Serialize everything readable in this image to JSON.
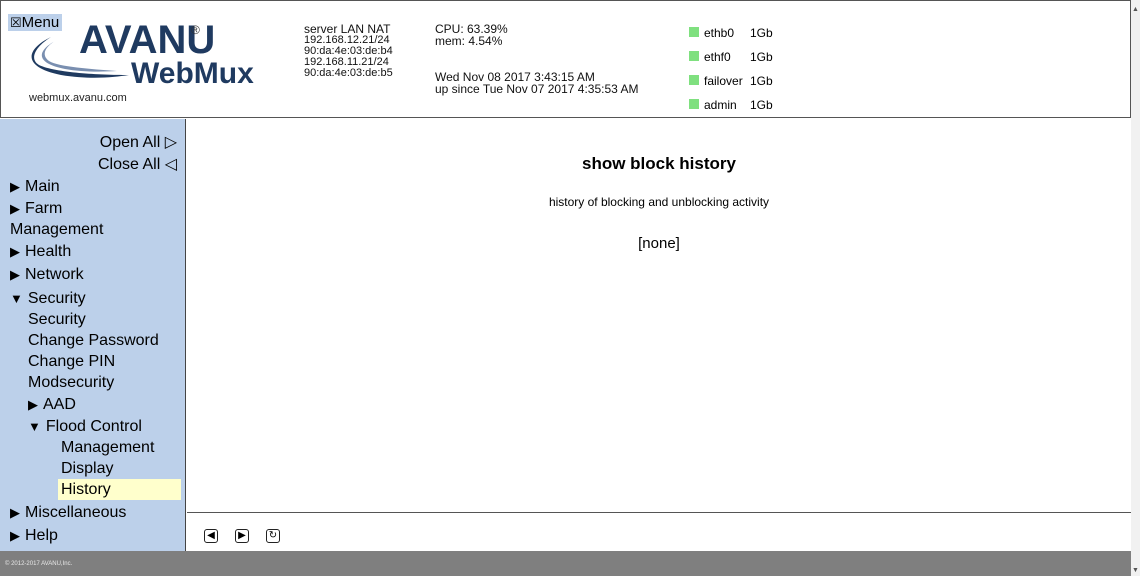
{
  "header": {
    "menu_label": "Menu",
    "menu_icon": "☒",
    "logo": {
      "brand": "AVANU",
      "reg": "®",
      "product": "WebMux"
    },
    "url": "webmux.avanu.com",
    "server": {
      "line1": "server LAN NAT",
      "ip1": "192.168.12.21/24",
      "mac1": "90:da:4e:03:de:b4",
      "ip2": "192.168.11.21/24",
      "mac2": "90:da:4e:03:de:b5"
    },
    "stats": {
      "cpu": "CPU: 63.39%",
      "mem": "mem: 4.54%",
      "date": "Wed Nov 08 2017 3:43:15 AM",
      "uptime": "up since Tue Nov 07 2017 4:35:53 AM"
    },
    "interfaces": [
      {
        "name": "ethb0",
        "speed": "1Gb",
        "status_color": "#7fe07f"
      },
      {
        "name": "ethf0",
        "speed": "1Gb",
        "status_color": "#7fe07f"
      },
      {
        "name": "failover",
        "speed": "1Gb",
        "status_color": "#7fe07f"
      },
      {
        "name": "admin",
        "speed": "1Gb",
        "status_color": "#7fe07f"
      }
    ]
  },
  "sidebar": {
    "open_all": "Open All ▷",
    "close_all": "Close All ◁",
    "collapsed_arrow": "▶",
    "expanded_arrow": "▼",
    "items": {
      "main": "Main",
      "farm": "Farm",
      "management": "Management",
      "health": "Health",
      "network": "Network",
      "security": "Security",
      "security_sub": "Security",
      "change_password": "Change Password",
      "change_pin": "Change PIN",
      "modsecurity": "Modsecurity",
      "aad": "AAD",
      "flood_control": "Flood Control",
      "fc_management": "Management",
      "fc_display": "Display",
      "fc_history": "History",
      "miscellaneous": "Miscellaneous",
      "help": "Help"
    },
    "selected_bg": "#ffffcc",
    "bg": "#bcd0ea"
  },
  "main": {
    "title": "show block history",
    "description": "history of blocking and unblocking activity",
    "result": "[none]"
  },
  "navbar": {
    "back_icon": "◀",
    "forward_icon": "▶",
    "refresh_icon": "↻"
  },
  "footer": {
    "copyright": "© 2012-2017 AVANU,Inc."
  }
}
